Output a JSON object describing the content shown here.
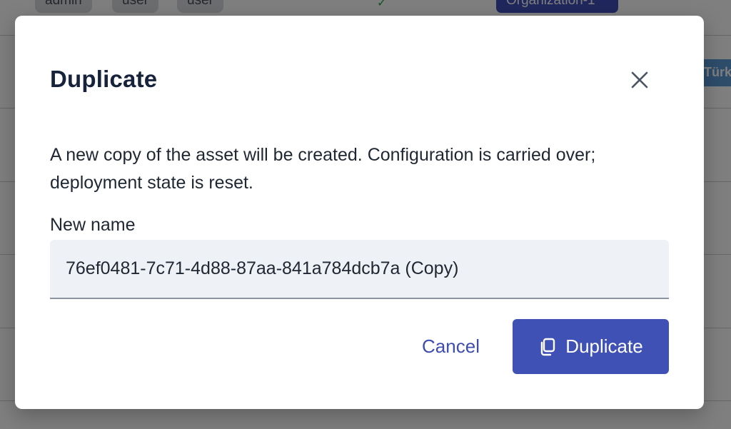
{
  "background": {
    "role_pills": [
      "admin",
      "user",
      "user"
    ],
    "organization_badge": "Organization-1",
    "language_badge": "Türk"
  },
  "dialog": {
    "title": "Duplicate",
    "description": "A new copy of the asset will be created. Configuration is carried over; deployment state is reset.",
    "field_label": "New name",
    "input_value": "76ef0481-7c71-4d88-87aa-841a784dcb7a (Copy)",
    "cancel_label": "Cancel",
    "confirm_label": "Duplicate",
    "icons": {
      "close": "close-icon",
      "confirm": "copy-icon"
    }
  },
  "colors": {
    "primary": "#3f51b5",
    "primary_text": "#3d4db0",
    "title_text": "#17223b",
    "input_bg": "#eef1f6"
  }
}
